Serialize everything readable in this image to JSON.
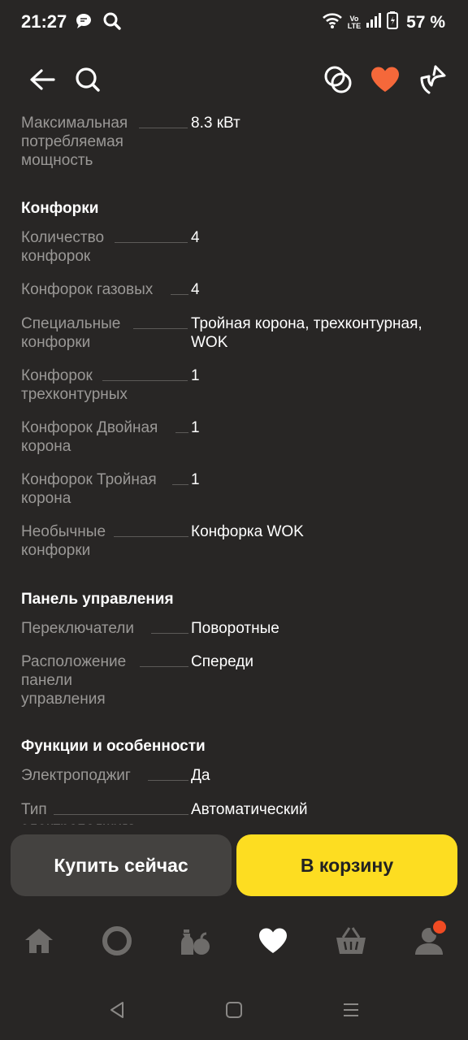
{
  "status_bar": {
    "time": "21:27",
    "volte_top": "Vo",
    "volte_bottom": "LTE",
    "battery": "57 %"
  },
  "top_nav": {
    "back_icon": "arrow-left-icon",
    "search_icon": "search-icon",
    "compare_icon": "compare-icon",
    "favorite_icon": "heart-icon",
    "share_icon": "share-icon",
    "favorite_color": "#f5683a"
  },
  "specs": {
    "power": {
      "label": "Максимальная потребляемая мощность",
      "value": "8.3 кВт"
    },
    "burners_title": "Конфорки",
    "burner_count": {
      "label": "Количество конфорок",
      "value": "4"
    },
    "burners_gas": {
      "label": "Конфорок газовых",
      "value": "4"
    },
    "burners_special": {
      "label": "Специальные конфорки",
      "value": "Тройная корона, трехконтурная, WOK"
    },
    "burners_triple_circuit": {
      "label": "Конфорок трехконтурных",
      "value": "1"
    },
    "burners_double_crown": {
      "label": "Конфорок Двойная корона",
      "value": "1"
    },
    "burners_triple_crown": {
      "label": "Конфорок Тройная корона",
      "value": "1"
    },
    "burners_unusual": {
      "label": "Необычные конфорки",
      "value": "Конфорка WOK"
    },
    "panel_title": "Панель управления",
    "switches": {
      "label": "Переключатели",
      "value": "Поворотные"
    },
    "panel_location": {
      "label": "Расположение панели управления",
      "value": "Спереди"
    },
    "features_title": "Функции и особенности",
    "ignition": {
      "label": "Электроподжиг",
      "value": "Да"
    },
    "ignition_type": {
      "label": "Тип электроподжига",
      "value": "Автоматический"
    }
  },
  "actions": {
    "buy_now": "Купить сейчас",
    "add_to_cart": "В корзину",
    "cart_color": "#fddd21"
  },
  "tab_bar": {
    "items": [
      "home-icon",
      "alice-icon",
      "catalog-icon",
      "favorites-icon",
      "cart-icon",
      "profile-icon"
    ],
    "active": "favorites-icon",
    "badge_color": "#f04b23"
  },
  "system_nav": [
    "back-triangle-icon",
    "home-square-icon",
    "menu-lines-icon"
  ]
}
